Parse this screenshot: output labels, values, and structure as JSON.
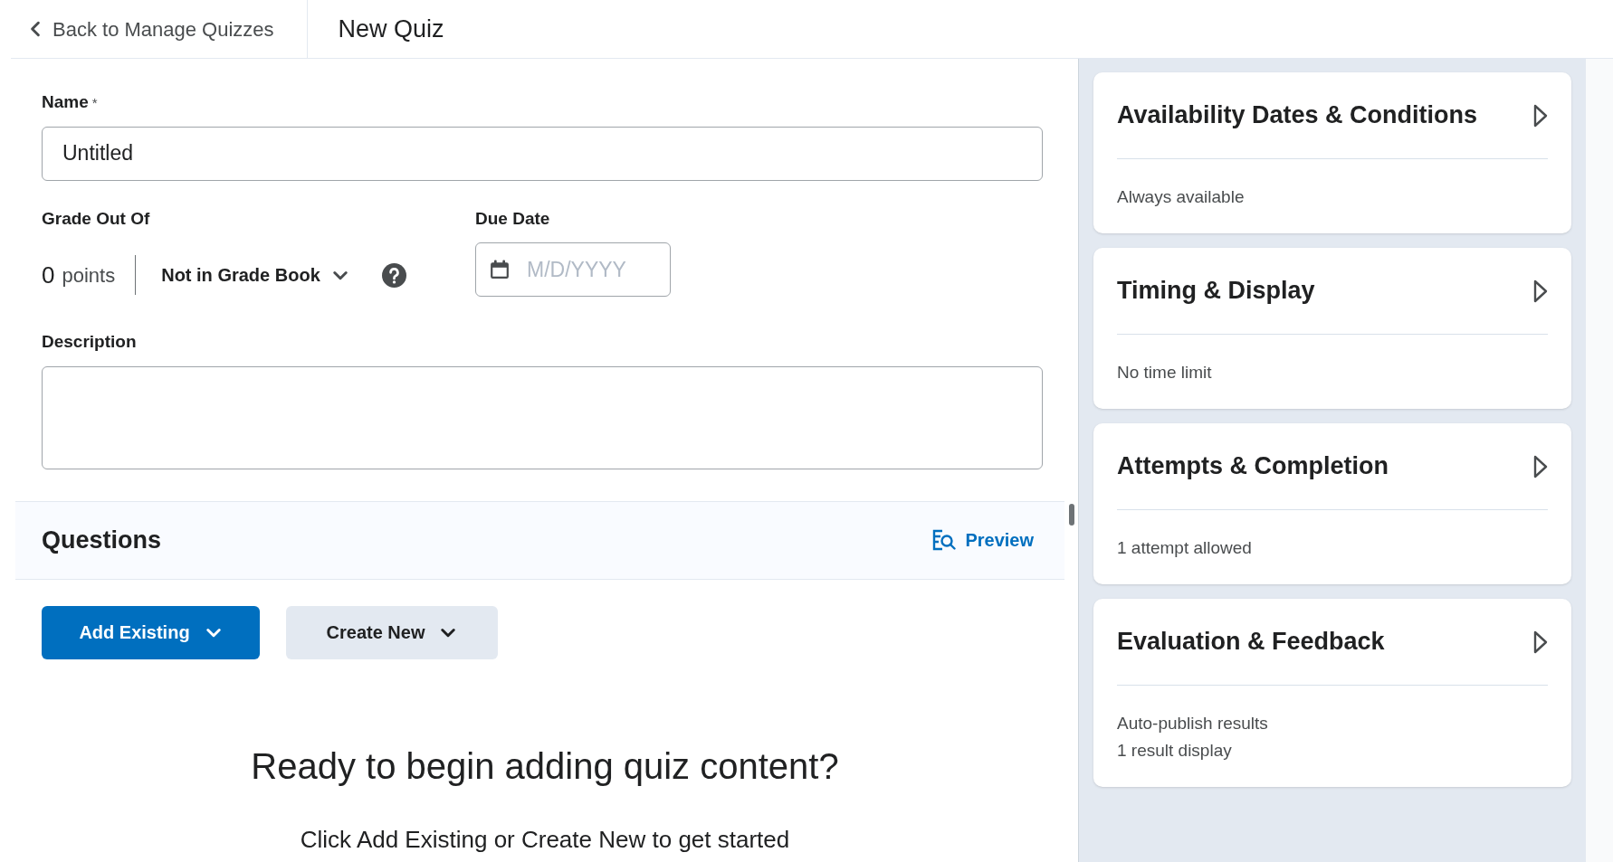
{
  "top_bar": {
    "back_link": "Back to Manage Quizzes",
    "title": "New Quiz"
  },
  "form": {
    "name": {
      "label": "Name",
      "required_mark": "*",
      "value": "Untitled"
    },
    "grade": {
      "label": "Grade Out Of",
      "value": "0",
      "unit": "points",
      "gradebook": "Not in Grade Book"
    },
    "due_date": {
      "label": "Due Date",
      "placeholder": "M/D/YYYY"
    },
    "description": {
      "label": "Description"
    }
  },
  "questions": {
    "title": "Questions",
    "preview": "Preview",
    "buttons": [
      {
        "label": "Add Existing",
        "kind": "primary"
      },
      {
        "label": "Create New",
        "kind": "secondary"
      }
    ],
    "empty_title": "Ready to begin adding quiz content?",
    "empty_text": "Click Add Existing or Create New to get started"
  },
  "settings_cards": [
    {
      "title": "Availability Dates & Conditions",
      "lines": [
        "Always available"
      ]
    },
    {
      "title": "Timing & Display",
      "lines": [
        "No time limit"
      ]
    },
    {
      "title": "Attempts & Completion",
      "lines": [
        "1 attempt allowed"
      ]
    },
    {
      "title": "Evaluation & Feedback",
      "lines": [
        "Auto-publish results",
        "1 result display"
      ]
    }
  ]
}
